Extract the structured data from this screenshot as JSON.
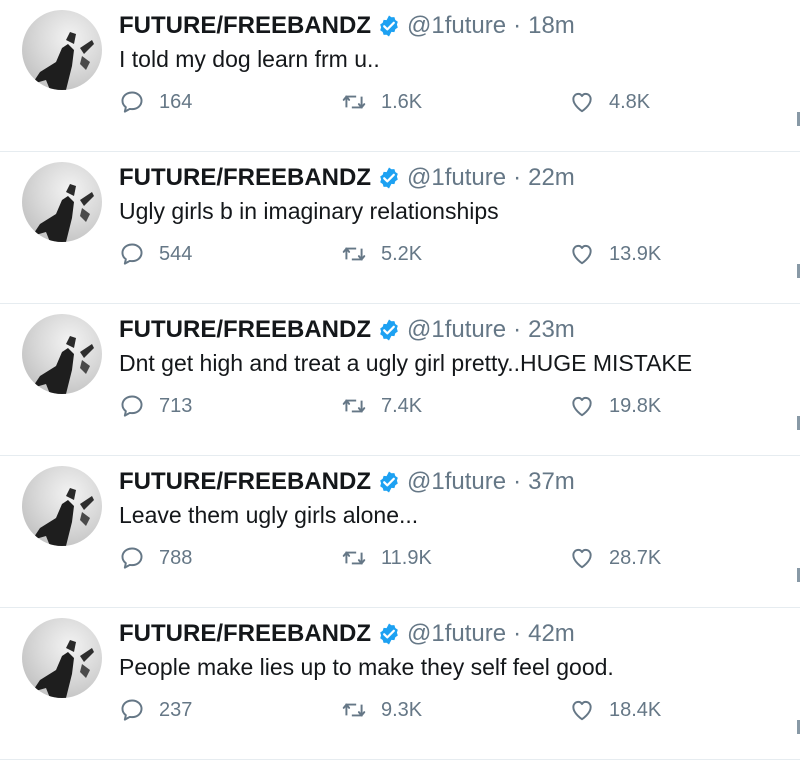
{
  "colors": {
    "verified_blue": "#1da1f2",
    "secondary_text": "#657786",
    "divider": "#e6ecf0"
  },
  "tweets": [
    {
      "author": "FUTURE/FREEBANDZ",
      "handle": "@1future",
      "separator": "·",
      "time": "18m",
      "text": "I told my dog learn frm u..",
      "replies": "164",
      "retweets": "1.6K",
      "likes": "4.8K",
      "icons": [
        "reply-icon",
        "retweet-icon",
        "like-icon",
        "verified-badge-icon"
      ]
    },
    {
      "author": "FUTURE/FREEBANDZ",
      "handle": "@1future",
      "separator": "·",
      "time": "22m",
      "text": "Ugly girls b in imaginary relationships",
      "replies": "544",
      "retweets": "5.2K",
      "likes": "13.9K"
    },
    {
      "author": "FUTURE/FREEBANDZ",
      "handle": "@1future",
      "separator": "·",
      "time": "23m",
      "text": "Dnt get high and treat a ugly girl pretty..HUGE MISTAKE",
      "replies": "713",
      "retweets": "7.4K",
      "likes": "19.8K"
    },
    {
      "author": "FUTURE/FREEBANDZ",
      "handle": "@1future",
      "separator": "·",
      "time": "37m",
      "text": "Leave them ugly girls alone...",
      "replies": "788",
      "retweets": "11.9K",
      "likes": "28.7K"
    },
    {
      "author": "FUTURE/FREEBANDZ",
      "handle": "@1future",
      "separator": "·",
      "time": "42m",
      "text": "People make lies up to make they self feel good.",
      "replies": "237",
      "retweets": "9.3K",
      "likes": "18.4K"
    }
  ]
}
